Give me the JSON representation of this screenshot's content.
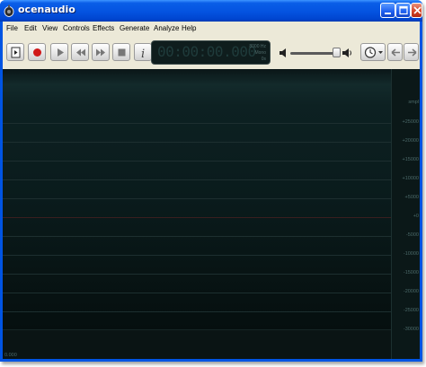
{
  "window": {
    "title": "ocenaudio"
  },
  "menu": [
    "File",
    "Edit",
    "View",
    "Controls",
    "Effects",
    "Generate",
    "Analyze",
    "Help"
  ],
  "display": {
    "time": "00:00:00.000",
    "rate": "8000 Hz",
    "mode": "Mono",
    "bits": "0s"
  },
  "scale": {
    "unit": "smpl",
    "labels": [
      "+25000",
      "+20000",
      "+15000",
      "+10000",
      "+5000",
      "+0",
      "-5000",
      "-10000",
      "-15000",
      "-20000",
      "-25000",
      "-30000"
    ]
  },
  "timeline": {
    "start": "0.000"
  },
  "colors": {
    "title_bar": "#0054e3",
    "waveform_bg": "#071010",
    "grid": "#1d2f30",
    "center_line": "#3a1f1f"
  }
}
